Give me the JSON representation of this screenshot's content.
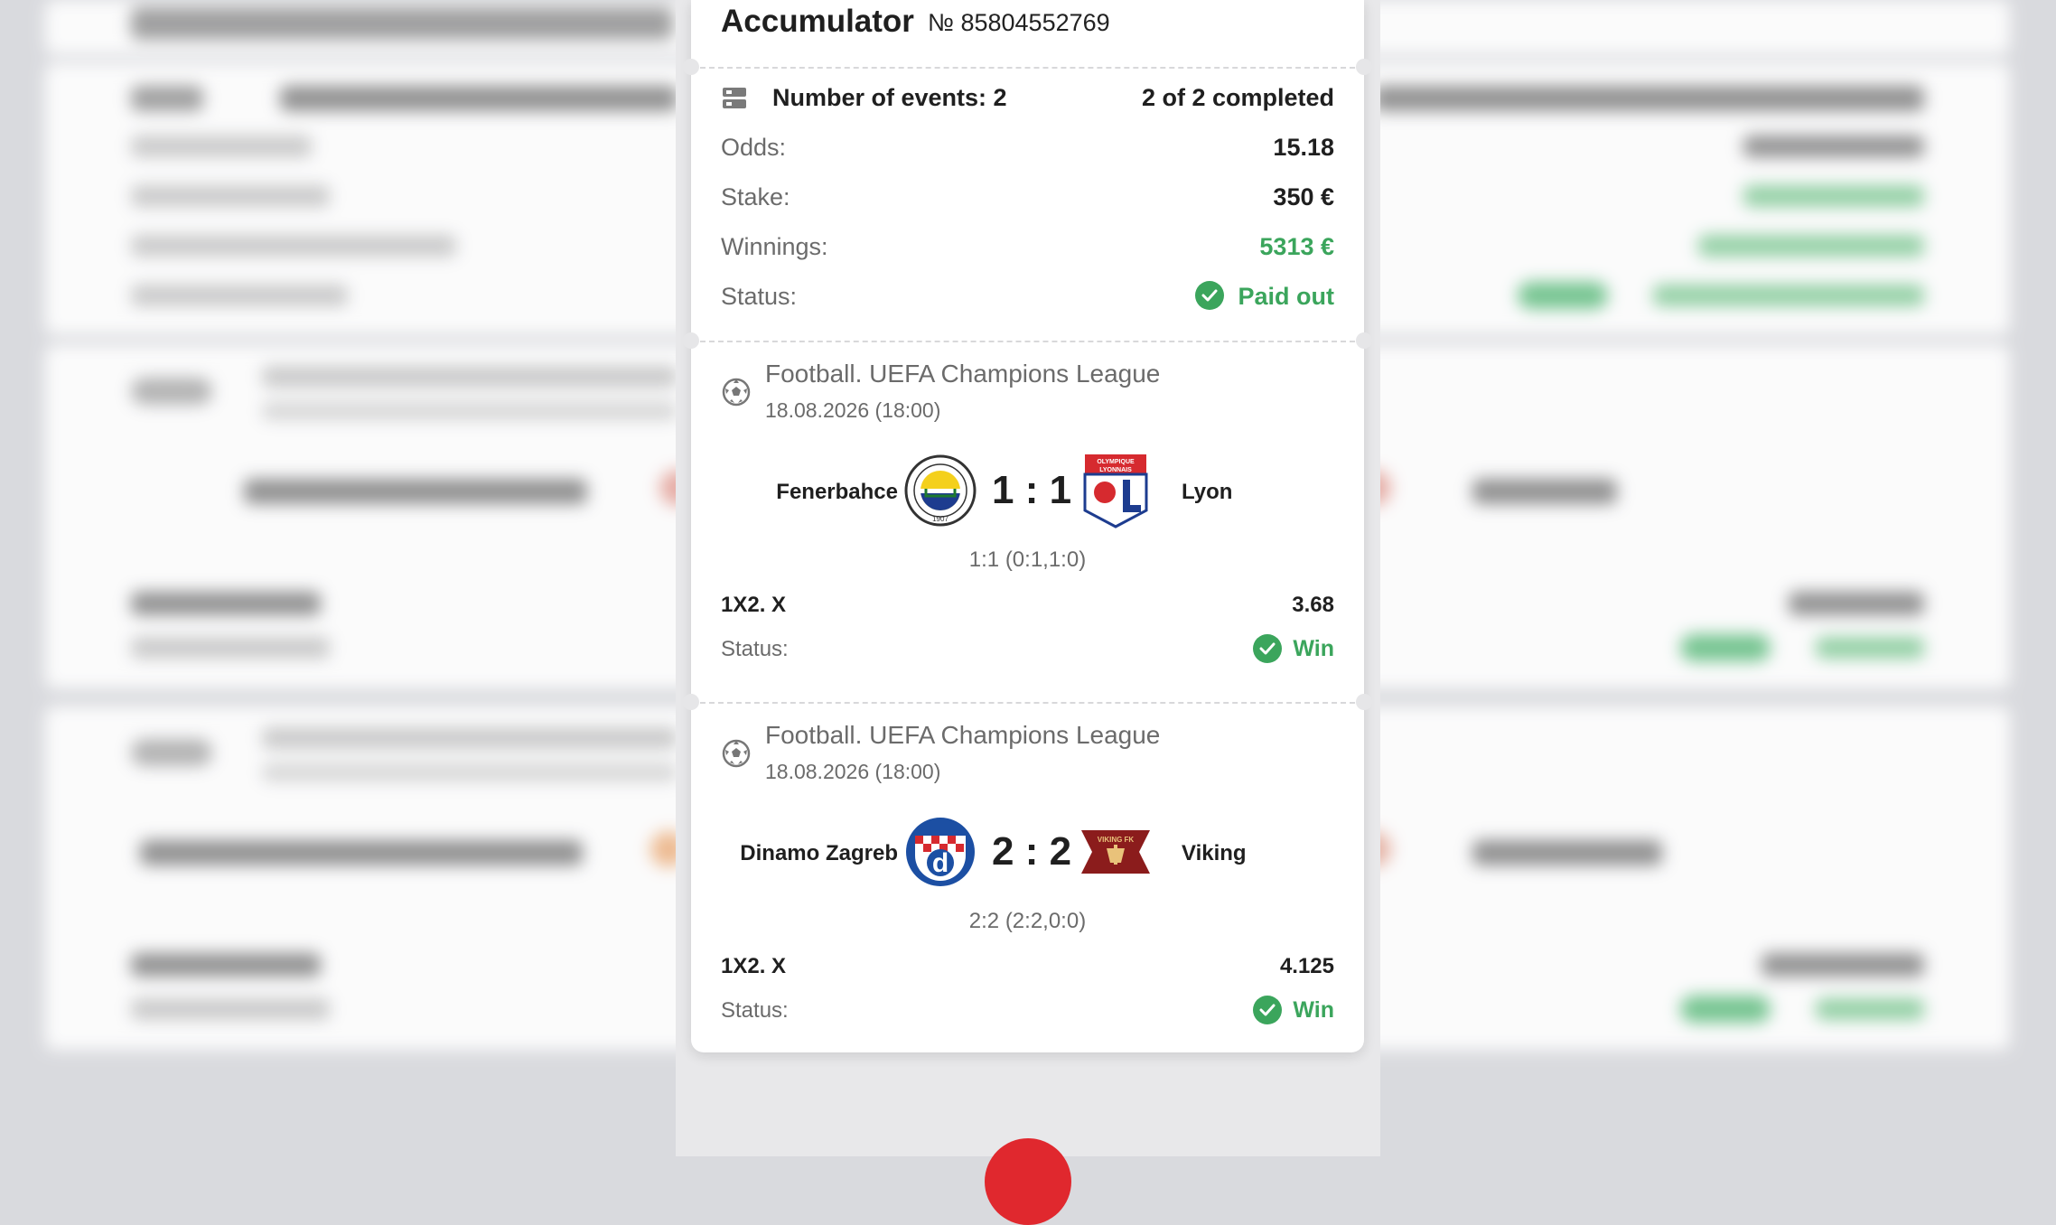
{
  "bet": {
    "title": "Accumulator",
    "ticket_number": "№ 85804552769",
    "events_label": "Number of events: 2",
    "completed": "2 of 2 completed",
    "odds_label": "Odds:",
    "odds_value": "15.18",
    "stake_label": "Stake:",
    "stake_value": "350 €",
    "winnings_label": "Winnings:",
    "winnings_value": "5313 €",
    "status_label": "Status:",
    "status_value": "Paid out"
  },
  "events": [
    {
      "league": "Football. UEFA Champions League",
      "datetime": "18.08.2026 (18:00)",
      "home_team": "Fenerbahce",
      "away_team": "Lyon",
      "score": "1 : 1",
      "score_detail": "1:1 (0:1,1:0)",
      "market": "1X2. X",
      "odd": "3.68",
      "status_label": "Status:",
      "status_value": "Win",
      "home_logo": "fenerbahce-crest",
      "away_logo": "olympique-lyonnais-crest"
    },
    {
      "league": "Football. UEFA Champions League",
      "datetime": "18.08.2026 (18:00)",
      "home_team": "Dinamo Zagreb",
      "away_team": "Viking",
      "score": "2 : 2",
      "score_detail": "2:2 (2:2,0:0)",
      "market": "1X2. X",
      "odd": "4.125",
      "status_label": "Status:",
      "status_value": "Win",
      "home_logo": "dinamo-zagreb-crest",
      "away_logo": "viking-fk-crest"
    }
  ],
  "logo_text": {
    "lyon": "OLYMPIQUE LYONNAIS",
    "viking": "VIKING FK",
    "fenerbahce_year": "1907"
  },
  "colors": {
    "accent_green": "#3ba55c",
    "fab_red": "#e0282e",
    "text_dark": "#1f1f1f",
    "text_muted": "#6b6b6b"
  },
  "icons": [
    "events-list-icon",
    "check-circle-icon",
    "football-icon"
  ]
}
